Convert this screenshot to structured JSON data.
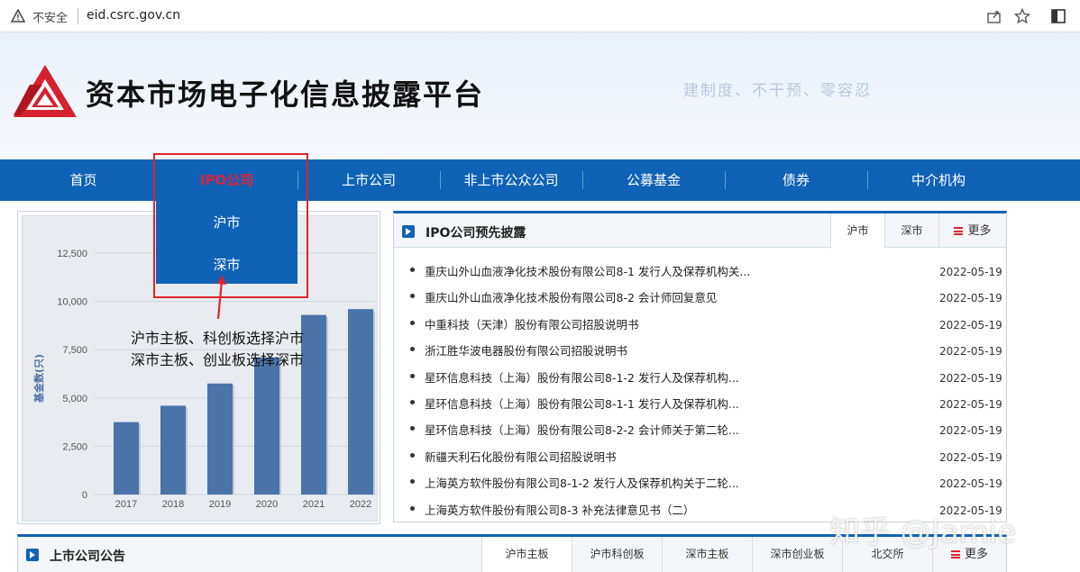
{
  "browser": {
    "security_label": "不安全",
    "url": "eid.csrc.gov.cn"
  },
  "header": {
    "site_title": "资本市场电子化信息披露平台",
    "slogan": "建制度、不干预、零容忍"
  },
  "nav": {
    "items": [
      "首页",
      "IPO公司",
      "上市公司",
      "非上市公众公司",
      "公募基金",
      "债券",
      "中介机构"
    ],
    "active_index": 1,
    "dropdown": [
      "沪市",
      "深市"
    ]
  },
  "annotation": {
    "line1": "沪市主板、科创板选择沪市",
    "line2": "深市主板、创业板选择深市"
  },
  "chart_data": {
    "type": "bar",
    "categories": [
      "2017",
      "2018",
      "2019",
      "2020",
      "2021",
      "2022"
    ],
    "values": [
      3750,
      4600,
      5750,
      7100,
      9300,
      9600
    ],
    "ylabel": "基金数(只)",
    "ylim": [
      0,
      12500
    ],
    "yticks": [
      "0",
      "2,500",
      "5,000",
      "7,500",
      "10,000",
      "12,500"
    ],
    "bar_color": "#4a73a8"
  },
  "ipo_panel": {
    "title": "IPO公司预先披露",
    "tabs": [
      "沪市",
      "深市"
    ],
    "active_tab": 0,
    "more_label": "更多",
    "items": [
      {
        "title": "重庆山外山血液净化技术股份有限公司8-1 发行人及保荐机构关...",
        "date": "2022-05-19"
      },
      {
        "title": "重庆山外山血液净化技术股份有限公司8-2 会计师回复意见",
        "date": "2022-05-19"
      },
      {
        "title": "中重科技（天津）股份有限公司招股说明书",
        "date": "2022-05-19"
      },
      {
        "title": "浙江胜华波电器股份有限公司招股说明书",
        "date": "2022-05-19"
      },
      {
        "title": "星环信息科技（上海）股份有限公司8-1-2 发行人及保荐机构...",
        "date": "2022-05-19"
      },
      {
        "title": "星环信息科技（上海）股份有限公司8-1-1 发行人及保荐机构...",
        "date": "2022-05-19"
      },
      {
        "title": "星环信息科技（上海）股份有限公司8-2-2 会计师关于第二轮...",
        "date": "2022-05-19"
      },
      {
        "title": "新疆天利石化股份有限公司招股说明书",
        "date": "2022-05-19"
      },
      {
        "title": "上海英方软件股份有限公司8-1-2 发行人及保荐机构关于二轮...",
        "date": "2022-05-19"
      },
      {
        "title": "上海英方软件股份有限公司8-3 补充法律意见书（二）",
        "date": "2022-05-19"
      }
    ]
  },
  "listed_panel": {
    "title": "上市公司公告",
    "tabs": [
      "沪市主板",
      "沪市科创板",
      "深市主板",
      "深市创业板",
      "北交所"
    ],
    "active_tab": 0,
    "more_label": "更多"
  },
  "watermark": "知乎 @Jamie",
  "colors": {
    "nav_blue": "#1062b6",
    "active_red": "#e2223a",
    "logo_red": "#d6222e"
  }
}
